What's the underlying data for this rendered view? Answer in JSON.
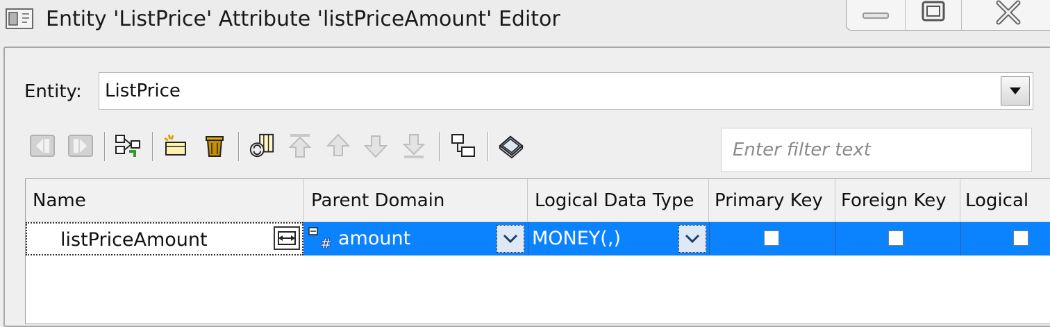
{
  "window": {
    "title": "Entity 'ListPrice' Attribute 'listPriceAmount' Editor",
    "icon": "editor-window-icon",
    "controls": [
      "minimize-icon",
      "maximize-icon",
      "close-icon"
    ]
  },
  "entity": {
    "label": "Entity:",
    "value": "ListPrice"
  },
  "toolbar": {
    "buttons": [
      {
        "icon": "move-left-icon",
        "enabled": false
      },
      {
        "icon": "move-right-icon",
        "enabled": false
      },
      {
        "icon": "navigate-hierarchy-icon",
        "enabled": true
      },
      {
        "icon": "new-attribute-icon",
        "enabled": true
      },
      {
        "icon": "delete-icon",
        "enabled": true
      },
      {
        "icon": "reorder-columns-icon",
        "enabled": true
      },
      {
        "icon": "move-to-top-icon",
        "enabled": false
      },
      {
        "icon": "move-up-icon",
        "enabled": false
      },
      {
        "icon": "move-down-icon",
        "enabled": false
      },
      {
        "icon": "move-to-bottom-icon",
        "enabled": false
      },
      {
        "icon": "show-relationships-icon",
        "enabled": true
      },
      {
        "icon": "properties-icon",
        "enabled": true
      }
    ],
    "filter_placeholder": "Enter filter text"
  },
  "table": {
    "columns": [
      "Name",
      "Parent Domain",
      "Logical Data Type",
      "Primary Key",
      "Foreign Key",
      "Logical"
    ],
    "rows": [
      {
        "name": "listPriceAmount",
        "parent_domain": "amount",
        "logical_data_type": "MONEY(,)",
        "primary_key": false,
        "foreign_key": false,
        "logical": false,
        "selected": true
      }
    ]
  },
  "colors": {
    "selection": "#0b83ff",
    "background": "#efefef"
  }
}
